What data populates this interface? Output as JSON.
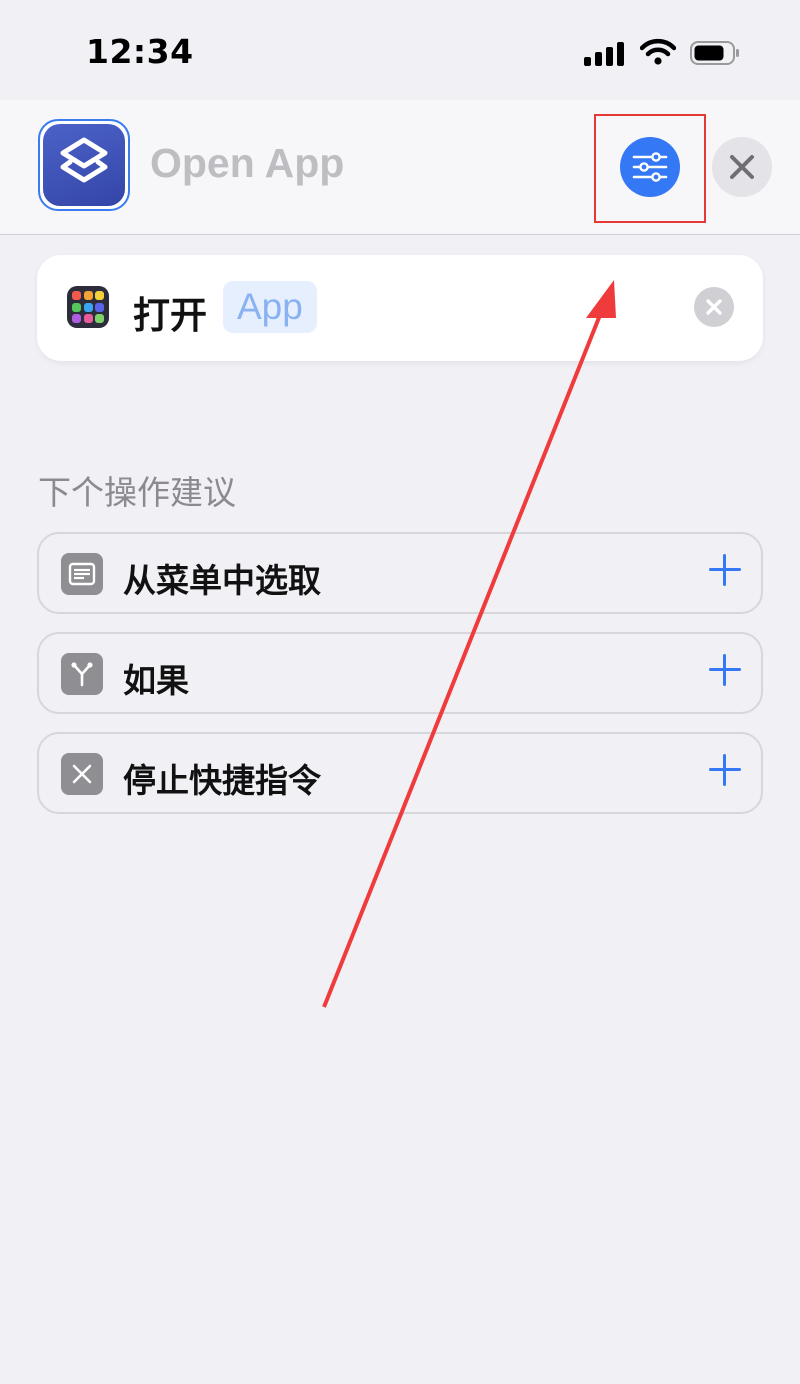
{
  "status_bar": {
    "time": "12:34"
  },
  "header": {
    "title": "Open App"
  },
  "action": {
    "verb": "打开",
    "token": "App"
  },
  "suggestions": {
    "title": "下个操作建议",
    "items": [
      {
        "label": "从菜单中选取",
        "icon": "menu-list-icon"
      },
      {
        "label": "如果",
        "icon": "branch-icon"
      },
      {
        "label": "停止快捷指令",
        "icon": "stop-x-icon"
      }
    ]
  },
  "colors": {
    "accent": "#3478f6",
    "annotation": "#e53935",
    "app_icon": "#3f52b5"
  }
}
